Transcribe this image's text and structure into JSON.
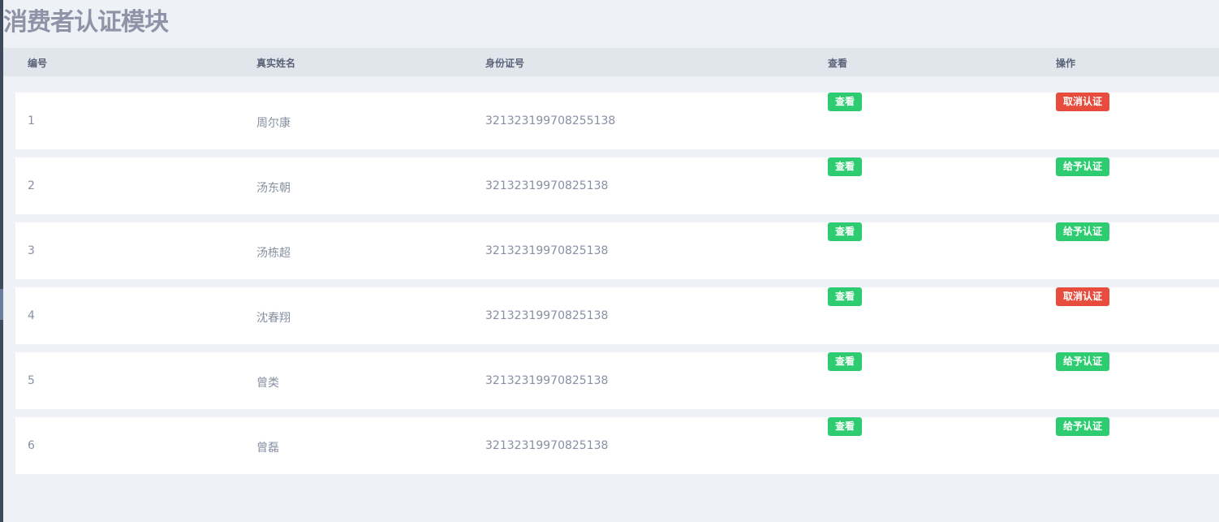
{
  "page": {
    "title": "消费者认证模块"
  },
  "table": {
    "headers": {
      "id": "编号",
      "name": "真实姓名",
      "idcard": "身份证号",
      "view": "查看",
      "action": "操作"
    },
    "rows": [
      {
        "id": "1",
        "name": "周尔康",
        "idcard": "321323199708255138",
        "view_label": "查看",
        "action_label": "取消认证",
        "action_type": "cancel"
      },
      {
        "id": "2",
        "name": "汤东朝",
        "idcard": "32132319970825138",
        "view_label": "查看",
        "action_label": "给予认证",
        "action_type": "grant"
      },
      {
        "id": "3",
        "name": "汤栋超",
        "idcard": "32132319970825138",
        "view_label": "查看",
        "action_label": "给予认证",
        "action_type": "grant"
      },
      {
        "id": "4",
        "name": "沈春翔",
        "idcard": "32132319970825138",
        "view_label": "查看",
        "action_label": "取消认证",
        "action_type": "cancel"
      },
      {
        "id": "5",
        "name": "曾类",
        "idcard": "32132319970825138",
        "view_label": "查看",
        "action_label": "给予认证",
        "action_type": "grant"
      },
      {
        "id": "6",
        "name": "曾磊",
        "idcard": "32132319970825138",
        "view_label": "查看",
        "action_label": "给予认证",
        "action_type": "grant"
      }
    ]
  },
  "colors": {
    "grant_button": "#2ecc71",
    "cancel_button": "#e74c3c",
    "view_button": "#2ecc71",
    "title": "#8e93a8"
  }
}
